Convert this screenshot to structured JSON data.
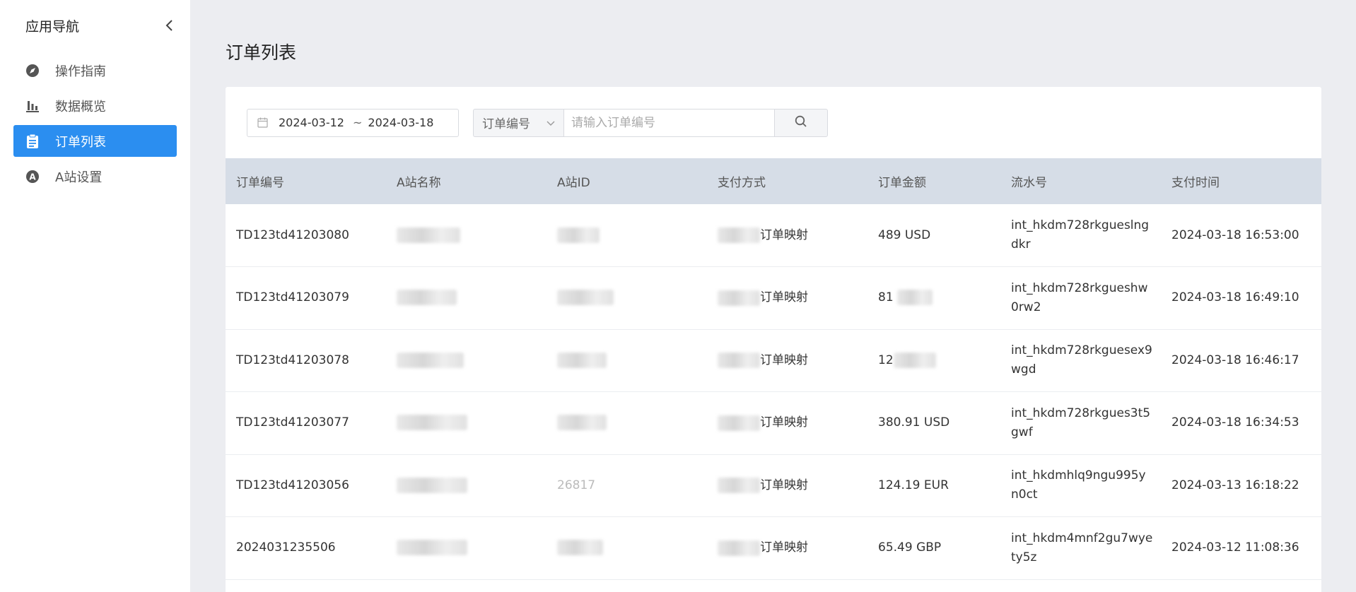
{
  "sidebar": {
    "title": "应用导航",
    "items": [
      {
        "label": "操作指南",
        "icon": "compass-icon",
        "active": false
      },
      {
        "label": "数据概览",
        "icon": "bar-chart-icon",
        "active": false
      },
      {
        "label": "订单列表",
        "icon": "clipboard-icon",
        "active": true
      },
      {
        "label": "A站设置",
        "icon": "letter-a-icon",
        "active": false
      }
    ]
  },
  "page": {
    "title": "订单列表"
  },
  "filters": {
    "date_start": "2024-03-12",
    "date_sep": "~",
    "date_end": "2024-03-18",
    "select_label": "订单编号",
    "search_placeholder": "请输入订单编号"
  },
  "table": {
    "headers": [
      "订单编号",
      "A站名称",
      "A站ID",
      "支付方式",
      "订单金额",
      "流水号",
      "支付时间"
    ],
    "rows": [
      {
        "order_no": "TD123td41203080",
        "pay_suffix": "订单映射",
        "amount": "489 USD",
        "txn": "int_hkdm728rkguеslng dkr",
        "time": "2024-03-18 16:53:00"
      },
      {
        "order_no": "TD123td41203079",
        "pay_suffix": "订单映射",
        "amount": "81",
        "txn": "int_hkdm728rkgueshw 0rw2",
        "time": "2024-03-18 16:49:10"
      },
      {
        "order_no": "TD123td41203078",
        "pay_suffix": "订单映射",
        "amount": "12",
        "txn": "int_hkdm728rkguesex9 wgd",
        "time": "2024-03-18 16:46:17"
      },
      {
        "order_no": "TD123td41203077",
        "pay_suffix": "订单映射",
        "amount": "380.91 USD",
        "txn": "int_hkdm728rkgues3t5 gwf",
        "time": "2024-03-18 16:34:53"
      },
      {
        "order_no": "TD123td41203056",
        "site_id": "26817",
        "pay_suffix": "订单映射",
        "amount": "124.19 EUR",
        "txn": "int_hkdmhlq9ngu995y n0ct",
        "time": "2024-03-13 16:18:22"
      },
      {
        "order_no": "2024031235506",
        "pay_suffix": "订单映射",
        "amount": "65.49 GBP",
        "txn": "int_hkdm4mnf2gu7wye ty5z",
        "time": "2024-03-12 11:08:36"
      }
    ]
  },
  "colors": {
    "accent": "#2b8ef0",
    "header_bg": "#d6dde7",
    "page_bg": "#ecedf1"
  }
}
